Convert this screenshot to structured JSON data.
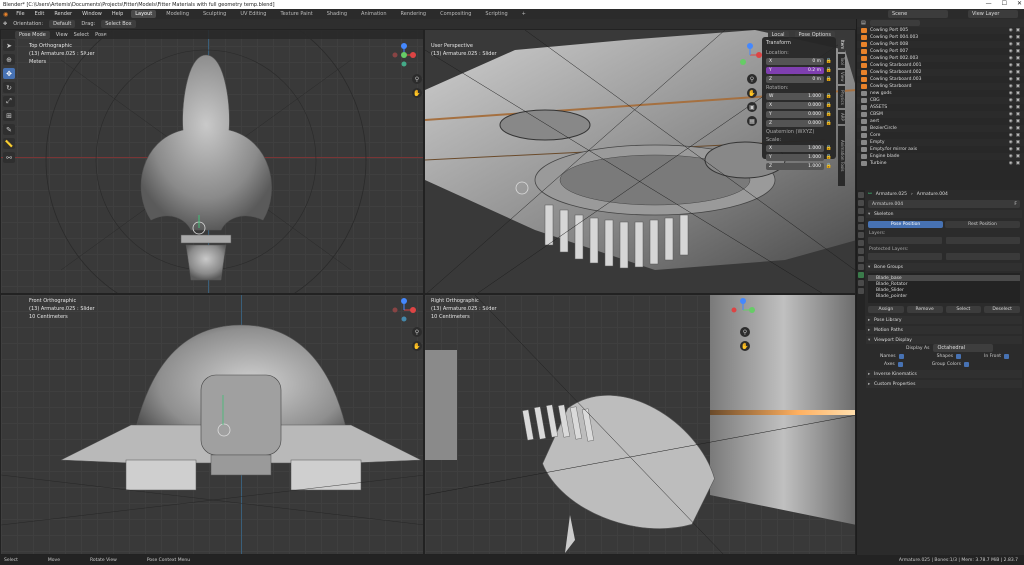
{
  "window": {
    "title": "Blender* [C:\\Users\\Artemis\\Documents\\Projects\\Fitter\\Models\\Fitter Materials with full geometry temp.blend]",
    "controls": [
      "—",
      "☐",
      "✕"
    ]
  },
  "menu": {
    "items": [
      "File",
      "Edit",
      "Render",
      "Window",
      "Help"
    ],
    "workspaces": [
      "Layout",
      "Modeling",
      "Sculpting",
      "UV Editing",
      "Texture Paint",
      "Shading",
      "Animation",
      "Rendering",
      "Compositing",
      "Scripting"
    ],
    "active_workspace": "Layout",
    "add_tab": "+",
    "scene_label": "Scene",
    "view_layer_label": "View Layer"
  },
  "tool_header": {
    "orientation_label": "Orientation:",
    "orientation_value": "Default",
    "drag_label": "Drag:",
    "drag_value": "Select Box",
    "mode": "Pose Mode",
    "menus": [
      "View",
      "Select",
      "Pose"
    ],
    "transform_orientation": "Local",
    "pose_options": "Pose Options"
  },
  "viewports": {
    "top": {
      "title": "Top Orthographic",
      "object": "(13) Armature.025 : Slider",
      "units": "Meters"
    },
    "user": {
      "title": "User Perspective",
      "object": "(13) Armature.025 : Slider"
    },
    "front": {
      "title": "Front Orthographic",
      "object": "(13) Armature.025 : Slider",
      "units": "10 Centimeters"
    },
    "right": {
      "title": "Right Orthographic",
      "object": "(13) Armature.025 : Slider",
      "units": "10 Centimeters"
    }
  },
  "npanel": {
    "header": "Transform",
    "location_label": "Location:",
    "location": [
      {
        "axis": "X",
        "value": "0 m"
      },
      {
        "axis": "Y",
        "value": "0.2 m"
      },
      {
        "axis": "Z",
        "value": "0 m"
      }
    ],
    "rotation_label": "Rotation:",
    "rotation": [
      {
        "axis": "W",
        "value": "1.000"
      },
      {
        "axis": "X",
        "value": "0.000"
      },
      {
        "axis": "Y",
        "value": "0.000"
      },
      {
        "axis": "Z",
        "value": "0.000"
      }
    ],
    "rotation_mode": "Quaternion (WXYZ)",
    "scale_label": "Scale:",
    "scale": [
      {
        "axis": "X",
        "value": "1.000"
      },
      {
        "axis": "Y",
        "value": "1.000"
      },
      {
        "axis": "Z",
        "value": "1.000"
      }
    ],
    "tabs": [
      "Item",
      "Tool",
      "View",
      "Physics",
      "ARP",
      "Animation Tools"
    ]
  },
  "outliner": {
    "rows": [
      "Cowling Port 005",
      "Cowling Port 004.003",
      "Cowling Port 008",
      "Cowling Port 007",
      "Cowling Port 002.003",
      "Cowling Starboard.001",
      "Cowling Starboard.002",
      "Cowling Starboard.003",
      "Cowling Starboard",
      "new gods",
      "CBG",
      "ASSETS",
      "CBSM",
      "aert",
      "BezierCircle",
      "Core",
      "Empty",
      "Empty.for mirror axis",
      "Engine blade",
      "Turbine"
    ]
  },
  "properties": {
    "breadcrumb": [
      "Armature.025",
      "Armature.004"
    ],
    "data_name": "Armature.004",
    "fake_user": "F",
    "users": "28",
    "skeleton": {
      "header": "Skeleton",
      "pose_position": "Pose Position",
      "rest_position": "Rest Position",
      "layers_label": "Layers:",
      "protected_label": "Protected Layers:"
    },
    "bone_groups": {
      "header": "Bone Groups",
      "items": [
        "Blade_base",
        "Blade_Rotator",
        "Blade_Slider",
        "Blade_pointer"
      ],
      "buttons": [
        "Assign",
        "Remove",
        "Select",
        "Deselect"
      ]
    },
    "sections": [
      "Pose Library",
      "Motion Paths"
    ],
    "viewport_display": {
      "header": "Viewport Display",
      "display_as_label": "Display As",
      "display_as_value": "Octahedral",
      "names": "Names",
      "shapes": "Shapes",
      "in_front": "In Front",
      "axes": "Axes",
      "group_colors": "Group Colors"
    },
    "more_sections": [
      "Inverse Kinematics",
      "Custom Properties"
    ]
  },
  "status": {
    "items": [
      "Select",
      "Move",
      "Rotate View",
      "Pose Context Menu"
    ],
    "version": "Armature.025 | Bones:1/3 | Mem: 3.78.7 MiB | 2.83.7"
  },
  "colors": {
    "accent_blue": "#4772b3",
    "selected_field": "#7f3fb0",
    "bone_orange": "#e8822a",
    "armature_green": "#3fbf75"
  }
}
